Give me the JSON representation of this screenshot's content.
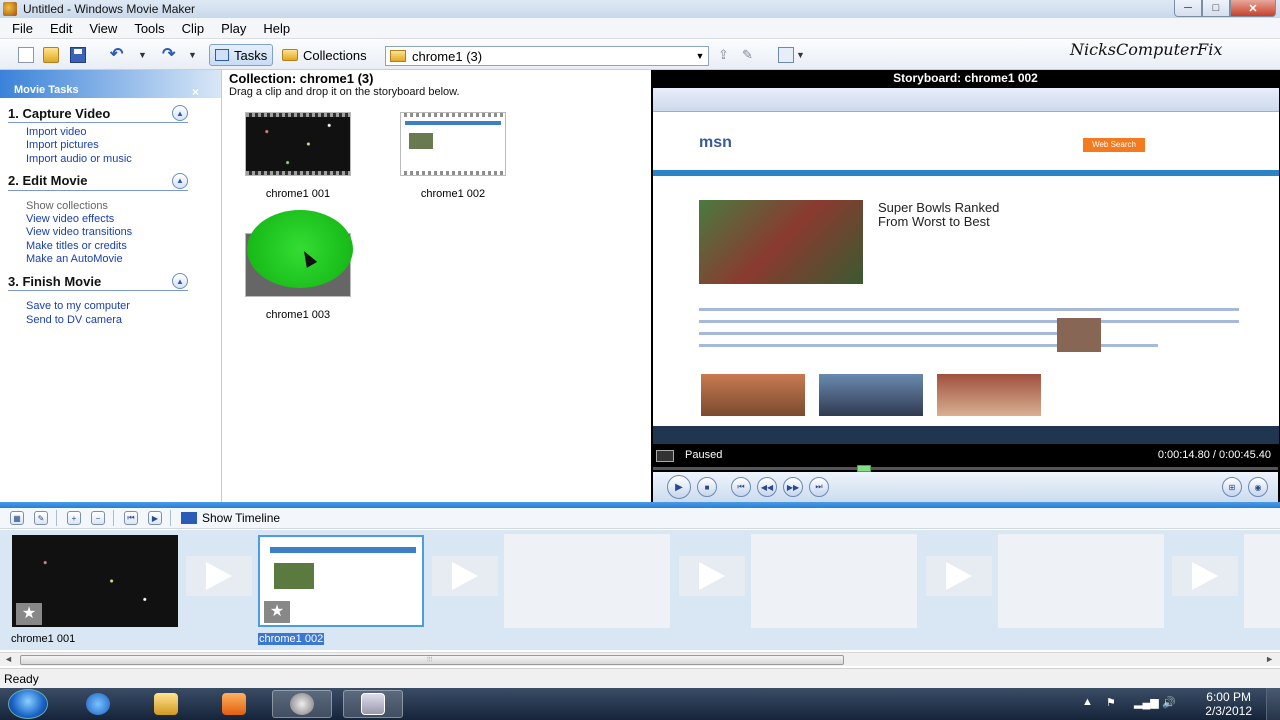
{
  "window": {
    "title": "Untitled - Windows Movie Maker",
    "minimize": "─",
    "maximize": "□",
    "close": "✕"
  },
  "menu": [
    "File",
    "Edit",
    "View",
    "Tools",
    "Clip",
    "Play",
    "Help"
  ],
  "toolbar": {
    "tasks_label": "Tasks",
    "collections_label": "Collections",
    "collection_select_value": "chrome1 (3)",
    "undo_glyph": "↶",
    "redo_glyph": "↷",
    "dropdown_glyph": "▼"
  },
  "watermark": "NicksComputerFix",
  "task_pane": {
    "header": "Movie Tasks",
    "close_glyph": "×",
    "sections": [
      {
        "title": "1. Capture Video",
        "links": [
          "Import video",
          "Import pictures",
          "Import audio or music"
        ]
      },
      {
        "title": "2. Edit Movie",
        "links": [
          "Show collections",
          "View video effects",
          "View video transitions",
          "Make titles or credits",
          "Make an AutoMovie"
        ]
      },
      {
        "title": "3. Finish Movie",
        "links": [
          "Save to my computer",
          "Send to DV camera"
        ]
      }
    ],
    "collapse_glyph": "▲"
  },
  "collection": {
    "heading": "Collection: chrome1 (3)",
    "hint": "Drag a clip and drop it on the storyboard below.",
    "clips": [
      "chrome1 001",
      "chrome1 002",
      "chrome1 003"
    ]
  },
  "preview": {
    "caption": "Storyboard: chrome1 002",
    "state": "Paused",
    "time": "0:00:14.80 / 0:00:45.40",
    "seek_fraction": 0.326,
    "page": {
      "logo": "msn",
      "search_button": "Web Search",
      "headline_1": "Super Bowls Ranked",
      "headline_2": "From Worst to Best"
    },
    "controls": {
      "play": "▶",
      "stop": "■",
      "prev": "⏮",
      "back": "◀◀",
      "fwd": "▶▶",
      "next": "⏭"
    }
  },
  "storyboard_toolbar": {
    "show_timeline": "Show Timeline"
  },
  "storyboard": {
    "clips": [
      "chrome1 001",
      "chrome1 002"
    ],
    "star_glyph": "★"
  },
  "scroll": {
    "left": "◄",
    "right": "►",
    "grip": "⦙⦙⦙"
  },
  "status": "Ready",
  "taskbar": {
    "time": "6:00 PM",
    "date": "2/3/2012"
  },
  "colors": {
    "accent": "#2a7fd4",
    "link": "#1a3fb0"
  }
}
